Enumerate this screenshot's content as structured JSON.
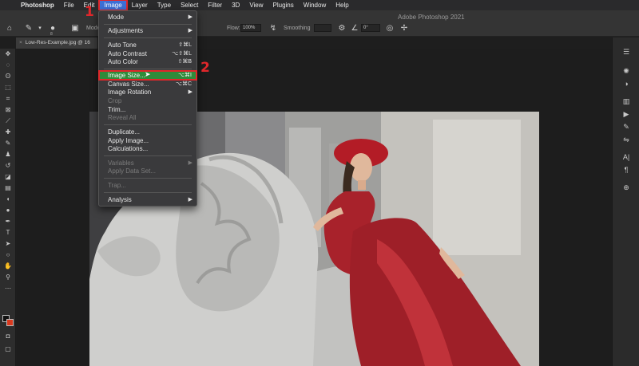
{
  "menubar": {
    "items": [
      "Photoshop",
      "File",
      "Edit",
      "Image",
      "Layer",
      "Type",
      "Select",
      "Filter",
      "3D",
      "View",
      "Plugins",
      "Window",
      "Help"
    ],
    "active": "Image"
  },
  "window_title": "Adobe Photoshop 2021",
  "options_bar": {
    "mode_label": "Mode",
    "flow_label": "Flow:",
    "flow_value": "100%",
    "smoothing_label": "Smoothing",
    "angle_value": "0°",
    "brush_size": "8"
  },
  "document_tab": {
    "name": "Low-Res-Example.jpg @ 16",
    "close": "×"
  },
  "image_menu": {
    "items": [
      {
        "label": "Mode",
        "submenu": true
      },
      {
        "label": "Adjustments",
        "submenu": true
      },
      {
        "label": "Auto Tone",
        "shortcut": "⇧⌘L"
      },
      {
        "label": "Auto Contrast",
        "shortcut": "⌥⇧⌘L"
      },
      {
        "label": "Auto Color",
        "shortcut": "⇧⌘B"
      },
      {
        "label": "Image Size...",
        "shortcut": "⌥⌘I",
        "highlighted": true
      },
      {
        "label": "Canvas Size...",
        "shortcut": "⌥⌘C"
      },
      {
        "label": "Image Rotation",
        "submenu": true
      },
      {
        "label": "Crop",
        "disabled": true
      },
      {
        "label": "Trim..."
      },
      {
        "label": "Reveal All",
        "disabled": true
      },
      {
        "label": "Duplicate..."
      },
      {
        "label": "Apply Image..."
      },
      {
        "label": "Calculations..."
      },
      {
        "label": "Variables",
        "submenu": true,
        "disabled": true
      },
      {
        "label": "Apply Data Set...",
        "disabled": true
      },
      {
        "label": "Trap...",
        "disabled": true
      },
      {
        "label": "Analysis",
        "submenu": true
      }
    ],
    "submenu_arrow": "▶"
  },
  "annotations": {
    "step1": "1",
    "step2": "2"
  },
  "colors": {
    "highlight_green": "#2f8b3a",
    "annotation_red": "#e0272b",
    "menu_bg": "#3a3a3c"
  }
}
